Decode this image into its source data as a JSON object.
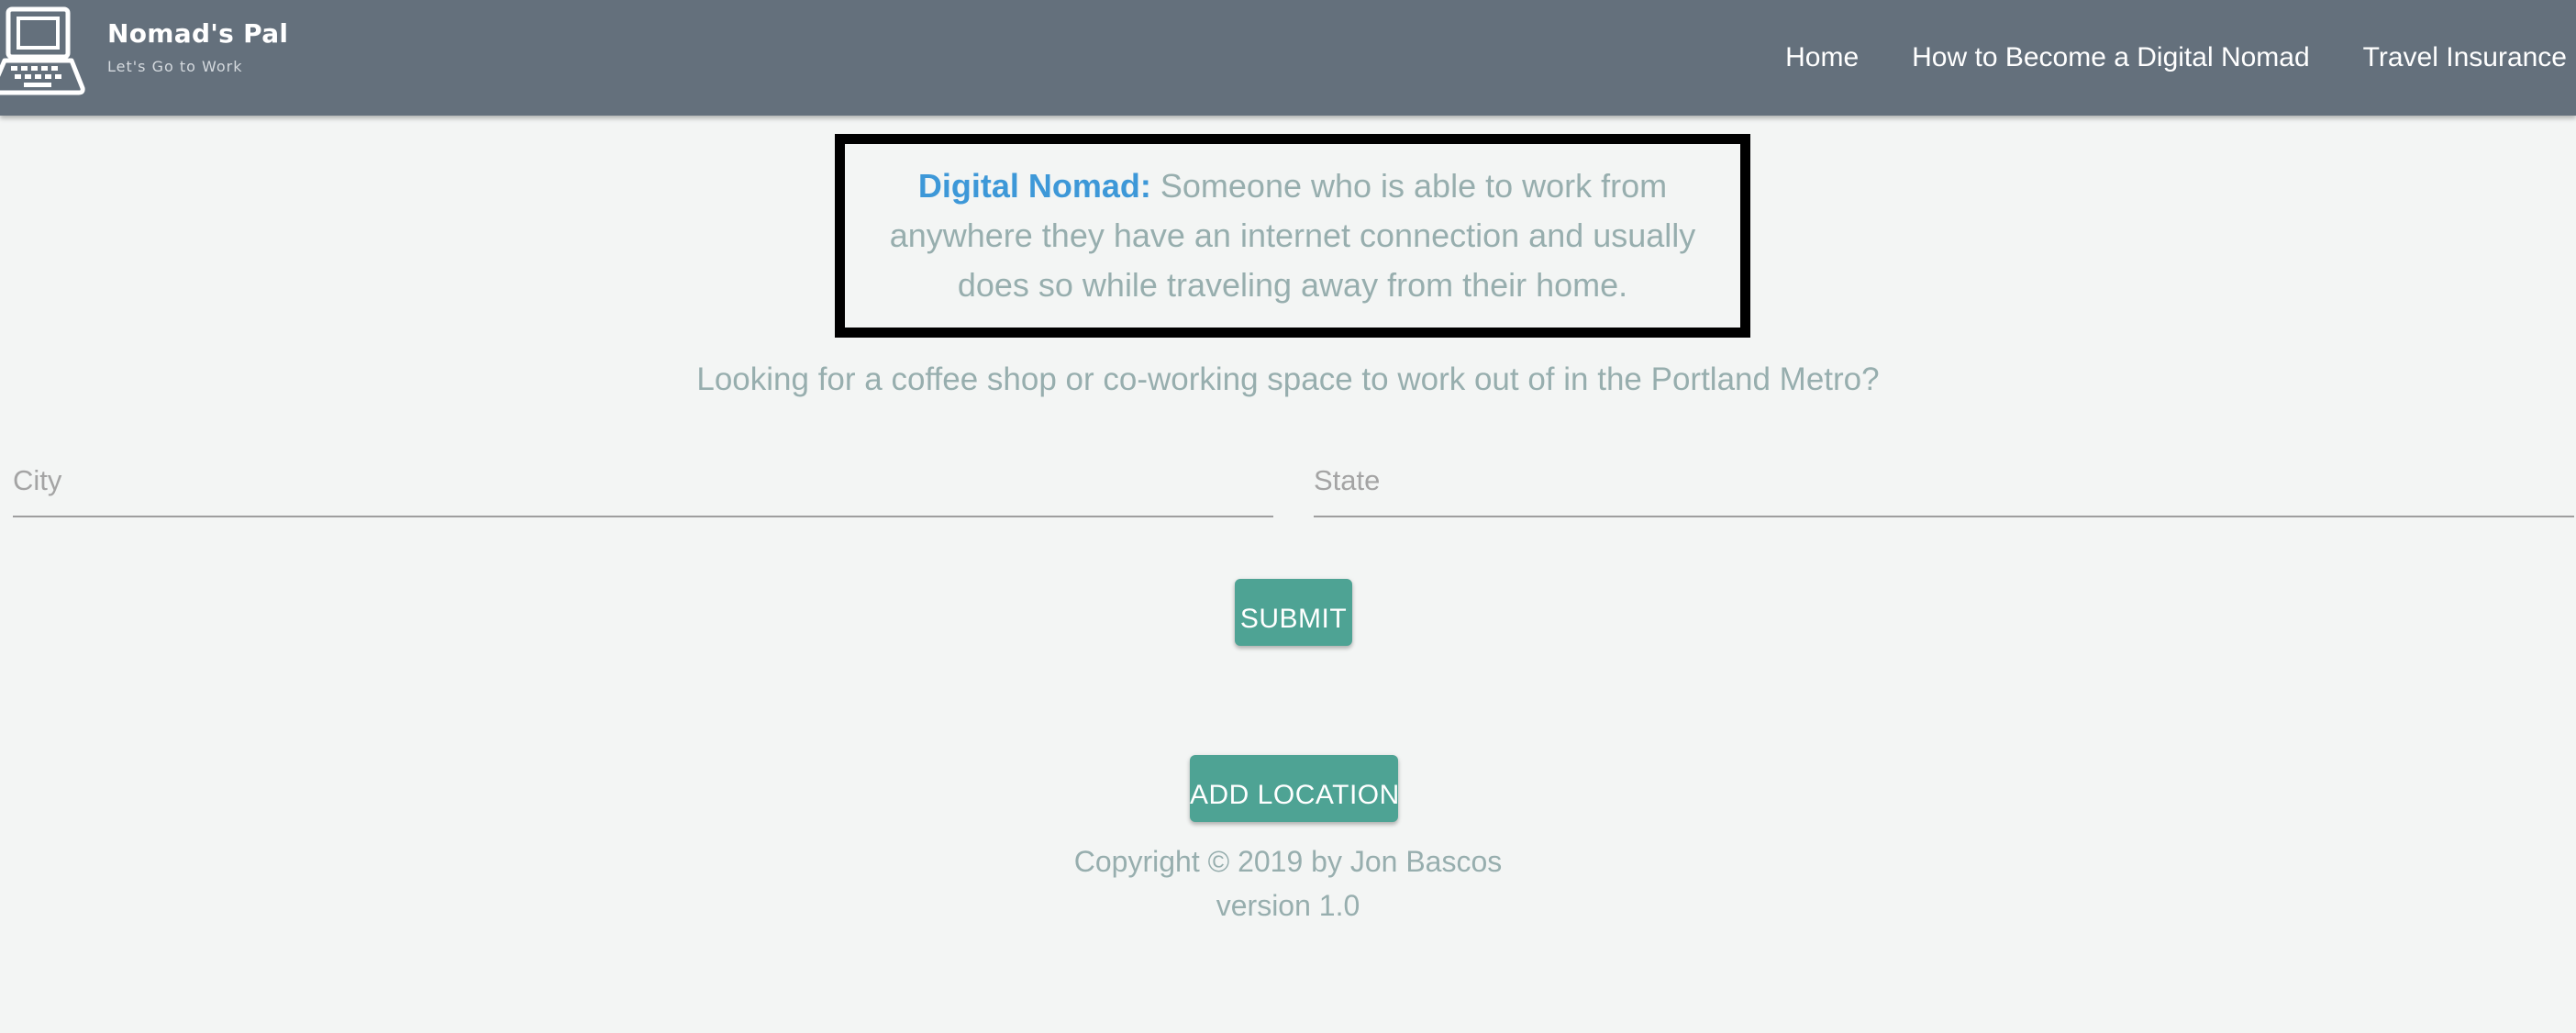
{
  "colors": {
    "navbar_bg": "#64707c",
    "page_bg": "#f3f5f4",
    "accent_teal": "#4ea394",
    "term_blue": "#3d98d8",
    "muted_text": "#97aeae",
    "box_border": "#000000"
  },
  "brand": {
    "logo_icon": "laptop-icon",
    "name": "Nomad's Pal",
    "tagline": "Let's Go to Work"
  },
  "nav": {
    "links": [
      {
        "label": "Home"
      },
      {
        "label": "How to Become a Digital Nomad"
      },
      {
        "label": "Travel Insurance"
      }
    ]
  },
  "definition": {
    "term": "Digital Nomad:",
    "text": " Someone who is able to work from anywhere they have an internet connection and usually does so while traveling away from their home."
  },
  "search": {
    "prompt": "Looking for a coffee shop or co-working space to work out of in the Portland Metro?",
    "city": {
      "placeholder": "City",
      "value": ""
    },
    "state": {
      "placeholder": "State",
      "value": ""
    },
    "submit_label": "Submit"
  },
  "actions": {
    "add_location_label": "Add Location"
  },
  "footer": {
    "copyright": "Copyright © 2019 by Jon Bascos",
    "version": "version 1.0"
  }
}
